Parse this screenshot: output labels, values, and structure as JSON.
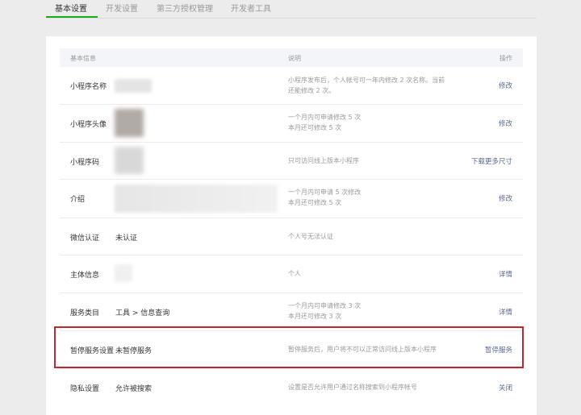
{
  "tabs": [
    "基本设置",
    "开发设置",
    "第三方授权管理",
    "开发者工具"
  ],
  "table": {
    "headers": {
      "info": "基本信息",
      "desc": "说明",
      "action": "操作"
    },
    "rows": [
      {
        "label": "小程序名称",
        "value": "",
        "desc": [
          "小程序发布后，个人帐号可一年内修改 2 次名称。当前",
          "还能修改 2 次。"
        ],
        "action": "修改"
      },
      {
        "label": "小程序头像",
        "value": "",
        "desc": [
          "一个月内可申请修改 5 次",
          "本月还可修改 5 次"
        ],
        "action": "修改"
      },
      {
        "label": "小程序码",
        "value": "",
        "desc": [
          "只可访问线上版本小程序"
        ],
        "action": "下载更多尺寸"
      },
      {
        "label": "介绍",
        "value": "",
        "desc": [
          "一个月内可申请 5 次修改",
          "本月还可修改 5 次"
        ],
        "action": "修改"
      },
      {
        "label": "微信认证",
        "value": "未认证",
        "desc": [
          "个人号无法认证"
        ],
        "action": ""
      },
      {
        "label": "主体信息",
        "value": "",
        "desc": [
          "个人"
        ],
        "action": "详情"
      },
      {
        "label": "服务类目",
        "value": "工具 > 信息查询",
        "desc": [
          "一个月内可申请修改 3 次",
          "本月还可修改 3 次"
        ],
        "action": "详情"
      },
      {
        "label": "暂停服务设置",
        "value": "未暂停服务",
        "desc": [
          "暂停服务后，用户将不可以正常访问线上版本小程序"
        ],
        "action": "暂停服务"
      },
      {
        "label": "隐私设置",
        "value": "允许被搜索",
        "desc": [
          "设置是否允许用户通过名称搜索到小程序帐号"
        ],
        "action": "关闭"
      }
    ]
  },
  "colors": {
    "accent": "#1aad19",
    "link": "#576b95",
    "highlight": "#c0282f"
  }
}
